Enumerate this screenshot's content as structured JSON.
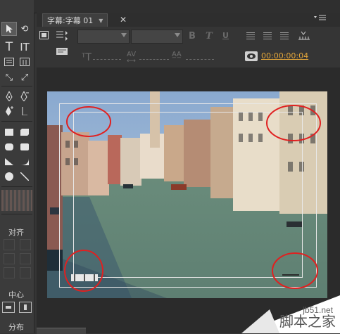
{
  "tab": {
    "title": "字幕:字幕 01"
  },
  "toolbar": {
    "bold": "B",
    "italic": "T",
    "underline": "U",
    "tracking": "AV",
    "timecode": "00:00:00:04"
  },
  "tools_panel": {
    "align_label": "对齐",
    "center_label": "中心",
    "distribute_label": "分布"
  },
  "watermark": {
    "site": "jb51.net",
    "name": "脚本之家"
  },
  "colors": {
    "accent_timecode": "#e2a53a",
    "annotation_circle": "#e02020",
    "panel_bg": "#353535"
  }
}
